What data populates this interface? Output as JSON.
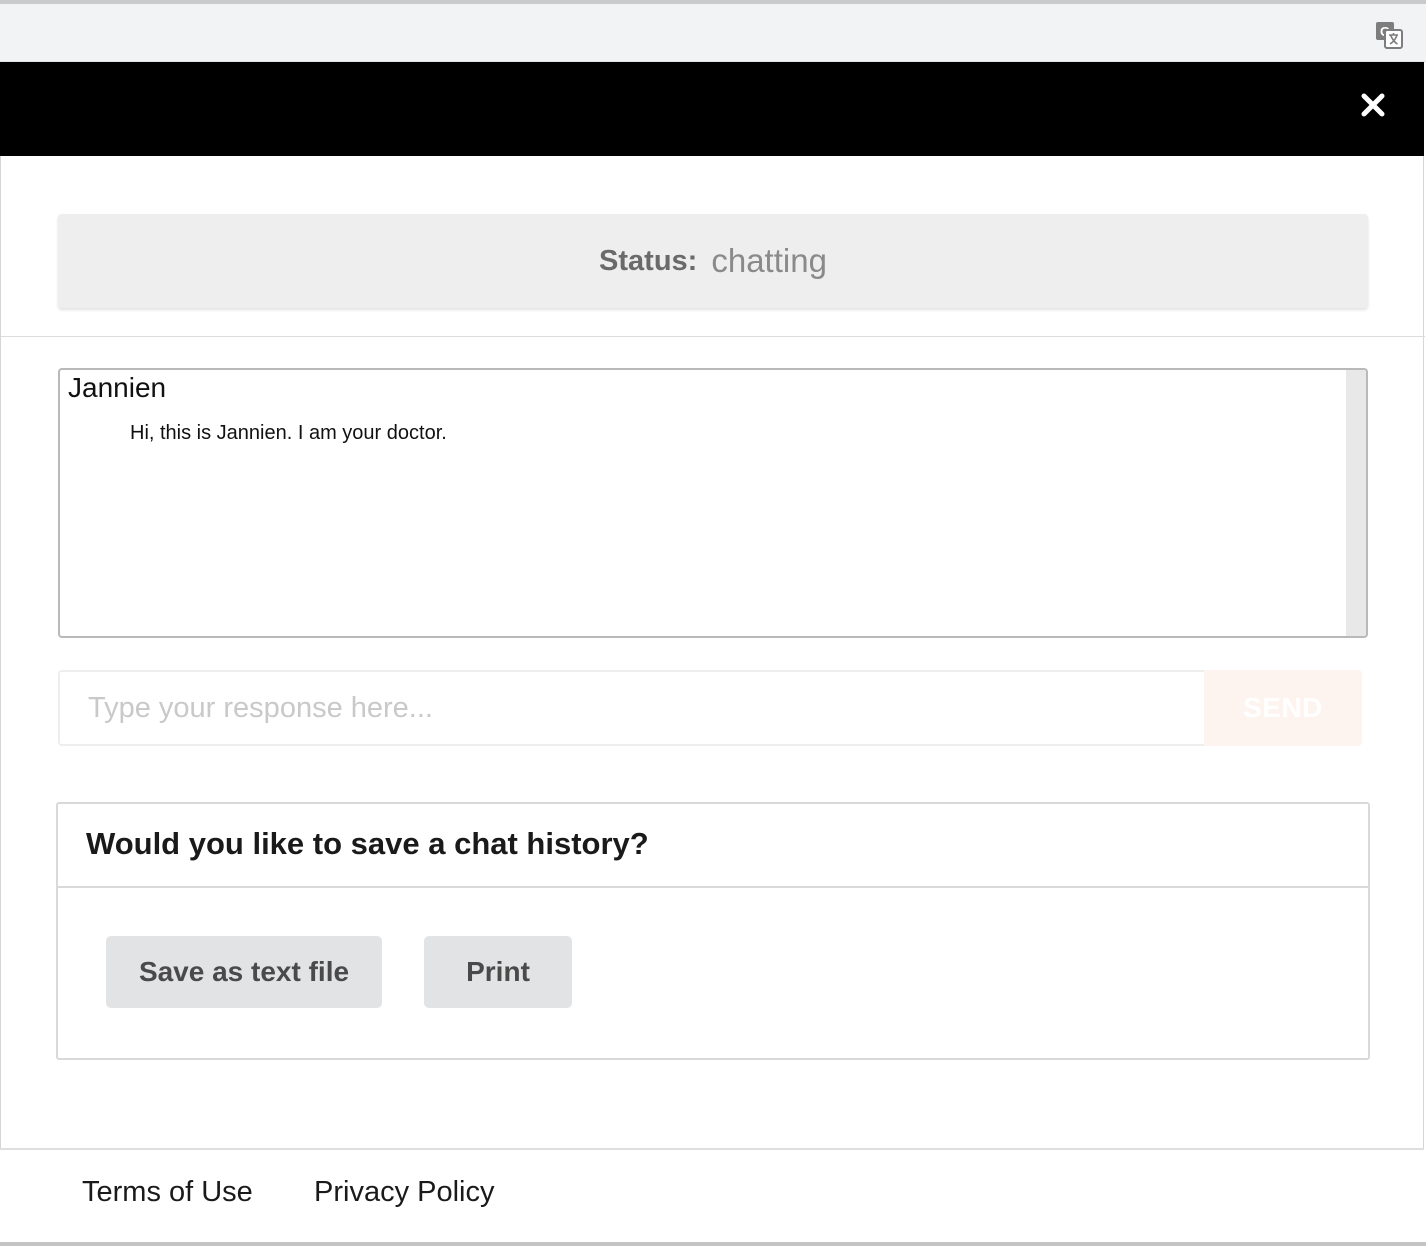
{
  "browser": {
    "translate_icon": "translate-icon"
  },
  "header": {
    "close_icon": "close-icon"
  },
  "status": {
    "label": "Status:",
    "value": "chatting"
  },
  "chat": {
    "messages": [
      {
        "sender": "Jannien",
        "text": "Hi, this is Jannien. I am your doctor."
      }
    ]
  },
  "composer": {
    "placeholder": "Type your response here...",
    "send_label": "SEND"
  },
  "save_history": {
    "title": "Would you like to save a chat history?",
    "save_text_label": "Save as text file",
    "print_label": "Print"
  },
  "footer": {
    "terms_label": "Terms of Use",
    "privacy_label": "Privacy Policy"
  },
  "colors": {
    "header_bg": "#000000",
    "status_bg": "#eeeeee",
    "button_bg": "#e2e3e5",
    "send_bg": "#fdf4ef"
  }
}
